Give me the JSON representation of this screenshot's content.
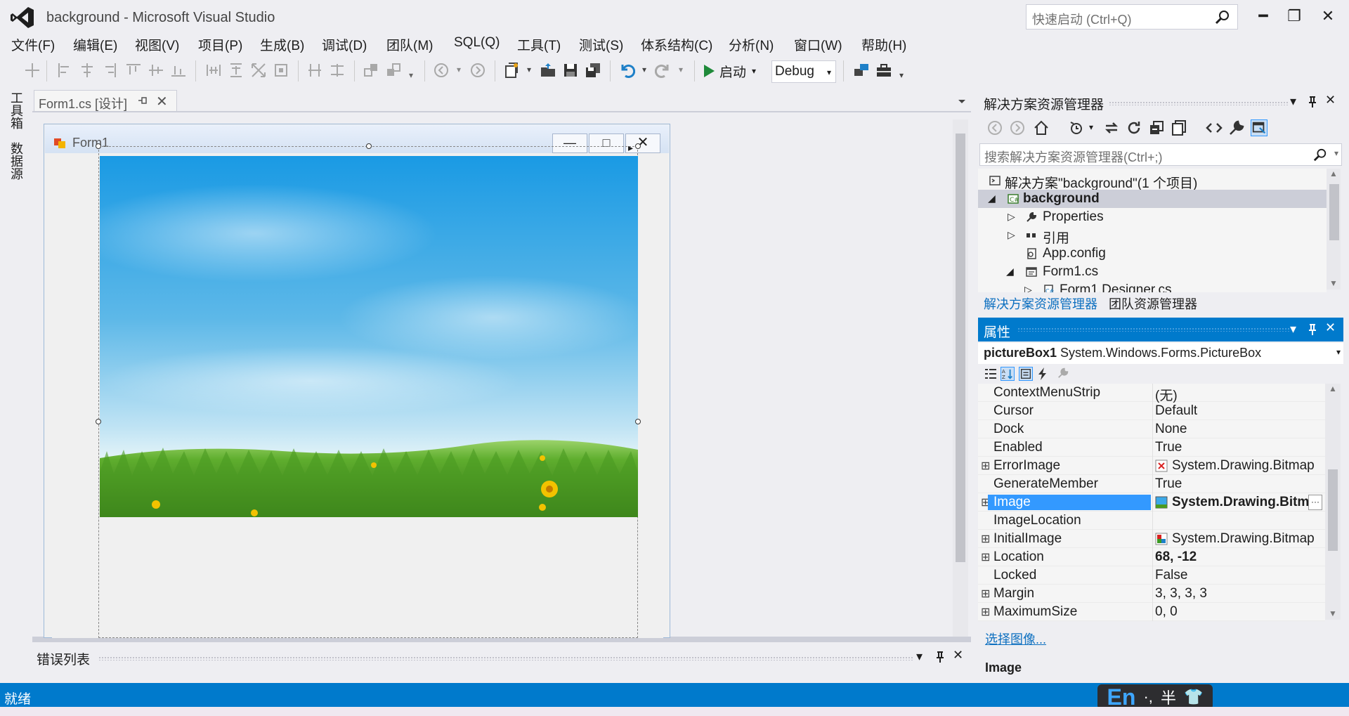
{
  "window": {
    "title": "background - Microsoft Visual Studio",
    "quick_launch_placeholder": "快速启动 (Ctrl+Q)",
    "minimize": "━",
    "restore": "❐",
    "close": "✕"
  },
  "menu": [
    "文件(F)",
    "编辑(E)",
    "视图(V)",
    "项目(P)",
    "生成(B)",
    "调试(D)",
    "团队(M)",
    "SQL(Q)",
    "工具(T)",
    "测试(S)",
    "体系结构(C)",
    "分析(N)",
    "窗口(W)",
    "帮助(H)"
  ],
  "toolbar": {
    "start_label": "启动",
    "config_value": "Debug",
    "icons": [
      "align-left-icon",
      "align-center-icon",
      "align-right-icon",
      "align-top-icon",
      "align-middle-icon",
      "align-bottom-icon",
      "same-width-icon",
      "same-height-icon",
      "same-size-icon",
      "size-to-grid-icon",
      "hspace-icon",
      "vspace-icon",
      "bring-front-icon",
      "send-back-icon",
      "navigate-back-icon",
      "navigate-forward-icon",
      "new-project-icon",
      "open-file-icon",
      "save-icon",
      "save-all-icon",
      "undo-icon",
      "redo-icon",
      "start-icon",
      "attach-icon",
      "toolbox-icon"
    ]
  },
  "left_tabs": [
    "工具箱",
    "数据源"
  ],
  "document_tab": {
    "label": "Form1.cs [设计]"
  },
  "form": {
    "title": "Form1",
    "min": "—",
    "max": "□",
    "close": "✕"
  },
  "error_list": {
    "title": "错误列表"
  },
  "status": {
    "text": "就绪"
  },
  "ime": {
    "lang": "En",
    "punct": "·,",
    "mode": "半",
    "shirt": "👕"
  },
  "solution_explorer": {
    "title": "解决方案资源管理器",
    "search_placeholder": "搜索解决方案资源管理器(Ctrl+;)",
    "tree": [
      {
        "label": "解决方案\"background\"(1 个项目)",
        "bold": false
      },
      {
        "label": "background",
        "bold": true
      },
      {
        "label": "Properties",
        "bold": false
      },
      {
        "label": "引用",
        "bold": false
      },
      {
        "label": "App.config",
        "bold": false
      },
      {
        "label": "Form1.cs",
        "bold": false
      },
      {
        "label": "Form1.Designer.cs",
        "bold": false
      }
    ],
    "tabs": [
      "解决方案资源管理器",
      "团队资源管理器"
    ]
  },
  "properties": {
    "title": "属性",
    "object_name": "pictureBox1",
    "object_type": "System.Windows.Forms.PictureBox",
    "rows": [
      {
        "name": "ContextMenuStrip",
        "value": "(无)",
        "expand": false,
        "bold": false
      },
      {
        "name": "Cursor",
        "value": "Default",
        "expand": false,
        "bold": false
      },
      {
        "name": "Dock",
        "value": "None",
        "expand": false,
        "bold": false
      },
      {
        "name": "Enabled",
        "value": "True",
        "expand": false,
        "bold": false
      },
      {
        "name": "ErrorImage",
        "value": "System.Drawing.Bitmap",
        "expand": true,
        "bold": false
      },
      {
        "name": "GenerateMember",
        "value": "True",
        "expand": false,
        "bold": false
      },
      {
        "name": "Image",
        "value": "System.Drawing.Bitm",
        "expand": true,
        "bold": true
      },
      {
        "name": "ImageLocation",
        "value": "",
        "expand": false,
        "bold": false
      },
      {
        "name": "InitialImage",
        "value": "System.Drawing.Bitmap",
        "expand": true,
        "bold": false
      },
      {
        "name": "Location",
        "value": "68, -12",
        "expand": true,
        "bold": true
      },
      {
        "name": "Locked",
        "value": "False",
        "expand": false,
        "bold": false
      },
      {
        "name": "Margin",
        "value": "3, 3, 3, 3",
        "expand": true,
        "bold": false
      },
      {
        "name": "MaximumSize",
        "value": "0, 0",
        "expand": true,
        "bold": false
      }
    ],
    "link": "选择图像...",
    "description_title": "Image"
  },
  "colors": {
    "accent": "#007acc",
    "link": "#0e70c0",
    "selection": "#3399ff"
  }
}
